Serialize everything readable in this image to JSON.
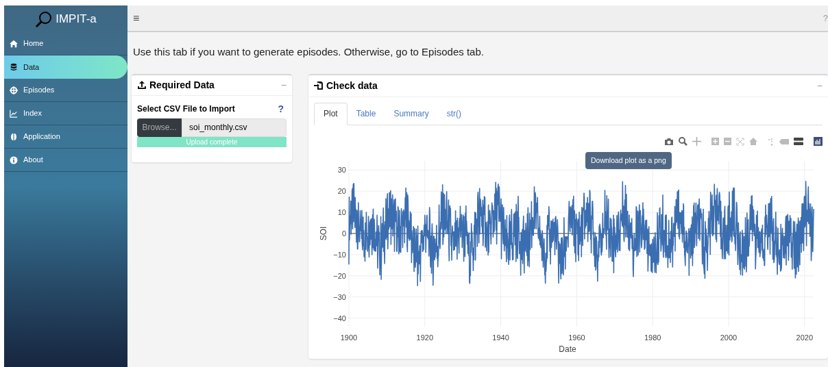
{
  "sidebar": {
    "title": "IMPIT-a",
    "items": [
      {
        "label": "Home",
        "selected": false
      },
      {
        "label": "Data",
        "selected": true
      },
      {
        "label": "Episodes",
        "selected": false
      },
      {
        "label": "Index",
        "selected": false
      },
      {
        "label": "Application",
        "selected": false
      },
      {
        "label": "About",
        "selected": false
      }
    ]
  },
  "header": {
    "menu": "≡",
    "help": "?"
  },
  "intro": "Use this tab if you want to generate episodes. Otherwise, go to Episodes tab.",
  "required_data": {
    "title": "Required Data",
    "collapse": "−",
    "label": "Select CSV File to Import",
    "help": "?",
    "browse": "Browse...",
    "file_name": "soi_monthly.csv",
    "progress": {
      "text": "Upload complete"
    }
  },
  "check_data": {
    "title": "Check data",
    "collapse": "−",
    "tabs": [
      {
        "label": "Plot",
        "selected": true
      },
      {
        "label": "Table",
        "selected": false
      },
      {
        "label": "Summary",
        "selected": false
      },
      {
        "label": "str()",
        "selected": false
      }
    ],
    "plot": {
      "tooltip": "Download plot as a png",
      "ylabel": "SOI",
      "xlabel": "Date",
      "yticks": [
        "30",
        "20",
        "10",
        "0",
        "−10",
        "−20",
        "−30",
        "−40"
      ],
      "xticks": [
        "1900",
        "1920",
        "1940",
        "1960",
        "1980",
        "2000",
        "2020"
      ]
    }
  }
}
